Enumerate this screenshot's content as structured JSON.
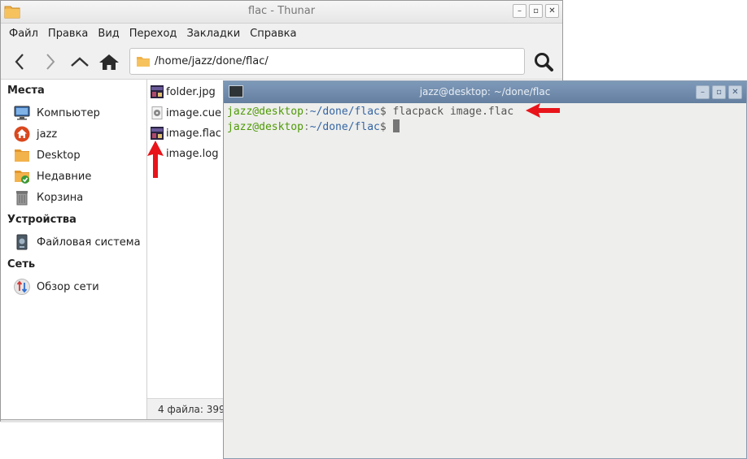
{
  "thunar": {
    "title": "flac - Thunar",
    "menu": [
      "Файл",
      "Правка",
      "Вид",
      "Переход",
      "Закладки",
      "Справка"
    ],
    "path": "/home/jazz/done/flac/",
    "sidebar": {
      "sections": [
        {
          "header": "Места",
          "items": [
            {
              "label": "Компьютер",
              "icon": "computer-icon"
            },
            {
              "label": "jazz",
              "icon": "home-icon"
            },
            {
              "label": "Desktop",
              "icon": "folder-icon"
            },
            {
              "label": "Недавние",
              "icon": "recent-icon"
            },
            {
              "label": "Корзина",
              "icon": "trash-icon"
            }
          ]
        },
        {
          "header": "Устройства",
          "items": [
            {
              "label": "Файловая система",
              "icon": "drive-icon"
            }
          ]
        },
        {
          "header": "Сеть",
          "items": [
            {
              "label": "Обзор сети",
              "icon": "network-icon"
            }
          ]
        }
      ]
    },
    "files": [
      {
        "name": "folder.jpg",
        "icon": "image-file-icon"
      },
      {
        "name": "image.cue",
        "icon": "cue-file-icon"
      },
      {
        "name": "image.flac",
        "icon": "flac-file-icon"
      },
      {
        "name": "image.log",
        "icon": "log-file-icon"
      }
    ],
    "status": "4 файла: 399"
  },
  "terminal": {
    "title": "jazz@desktop: ~/done/flac",
    "lines": [
      {
        "user": "jazz@desktop",
        "sep": ":",
        "path": "~/done/flac",
        "dollar": "$",
        "cmd": " flacpack image.flac"
      },
      {
        "user": "jazz@desktop",
        "sep": ":",
        "path": "~/done/flac",
        "dollar": "$",
        "cmd": " "
      }
    ]
  },
  "colors": {
    "annotation_arrow": "#e8141a",
    "terminal_user": "#4e9a06",
    "terminal_path": "#3465a4",
    "terminal_titlebar": "#6f8aab"
  }
}
